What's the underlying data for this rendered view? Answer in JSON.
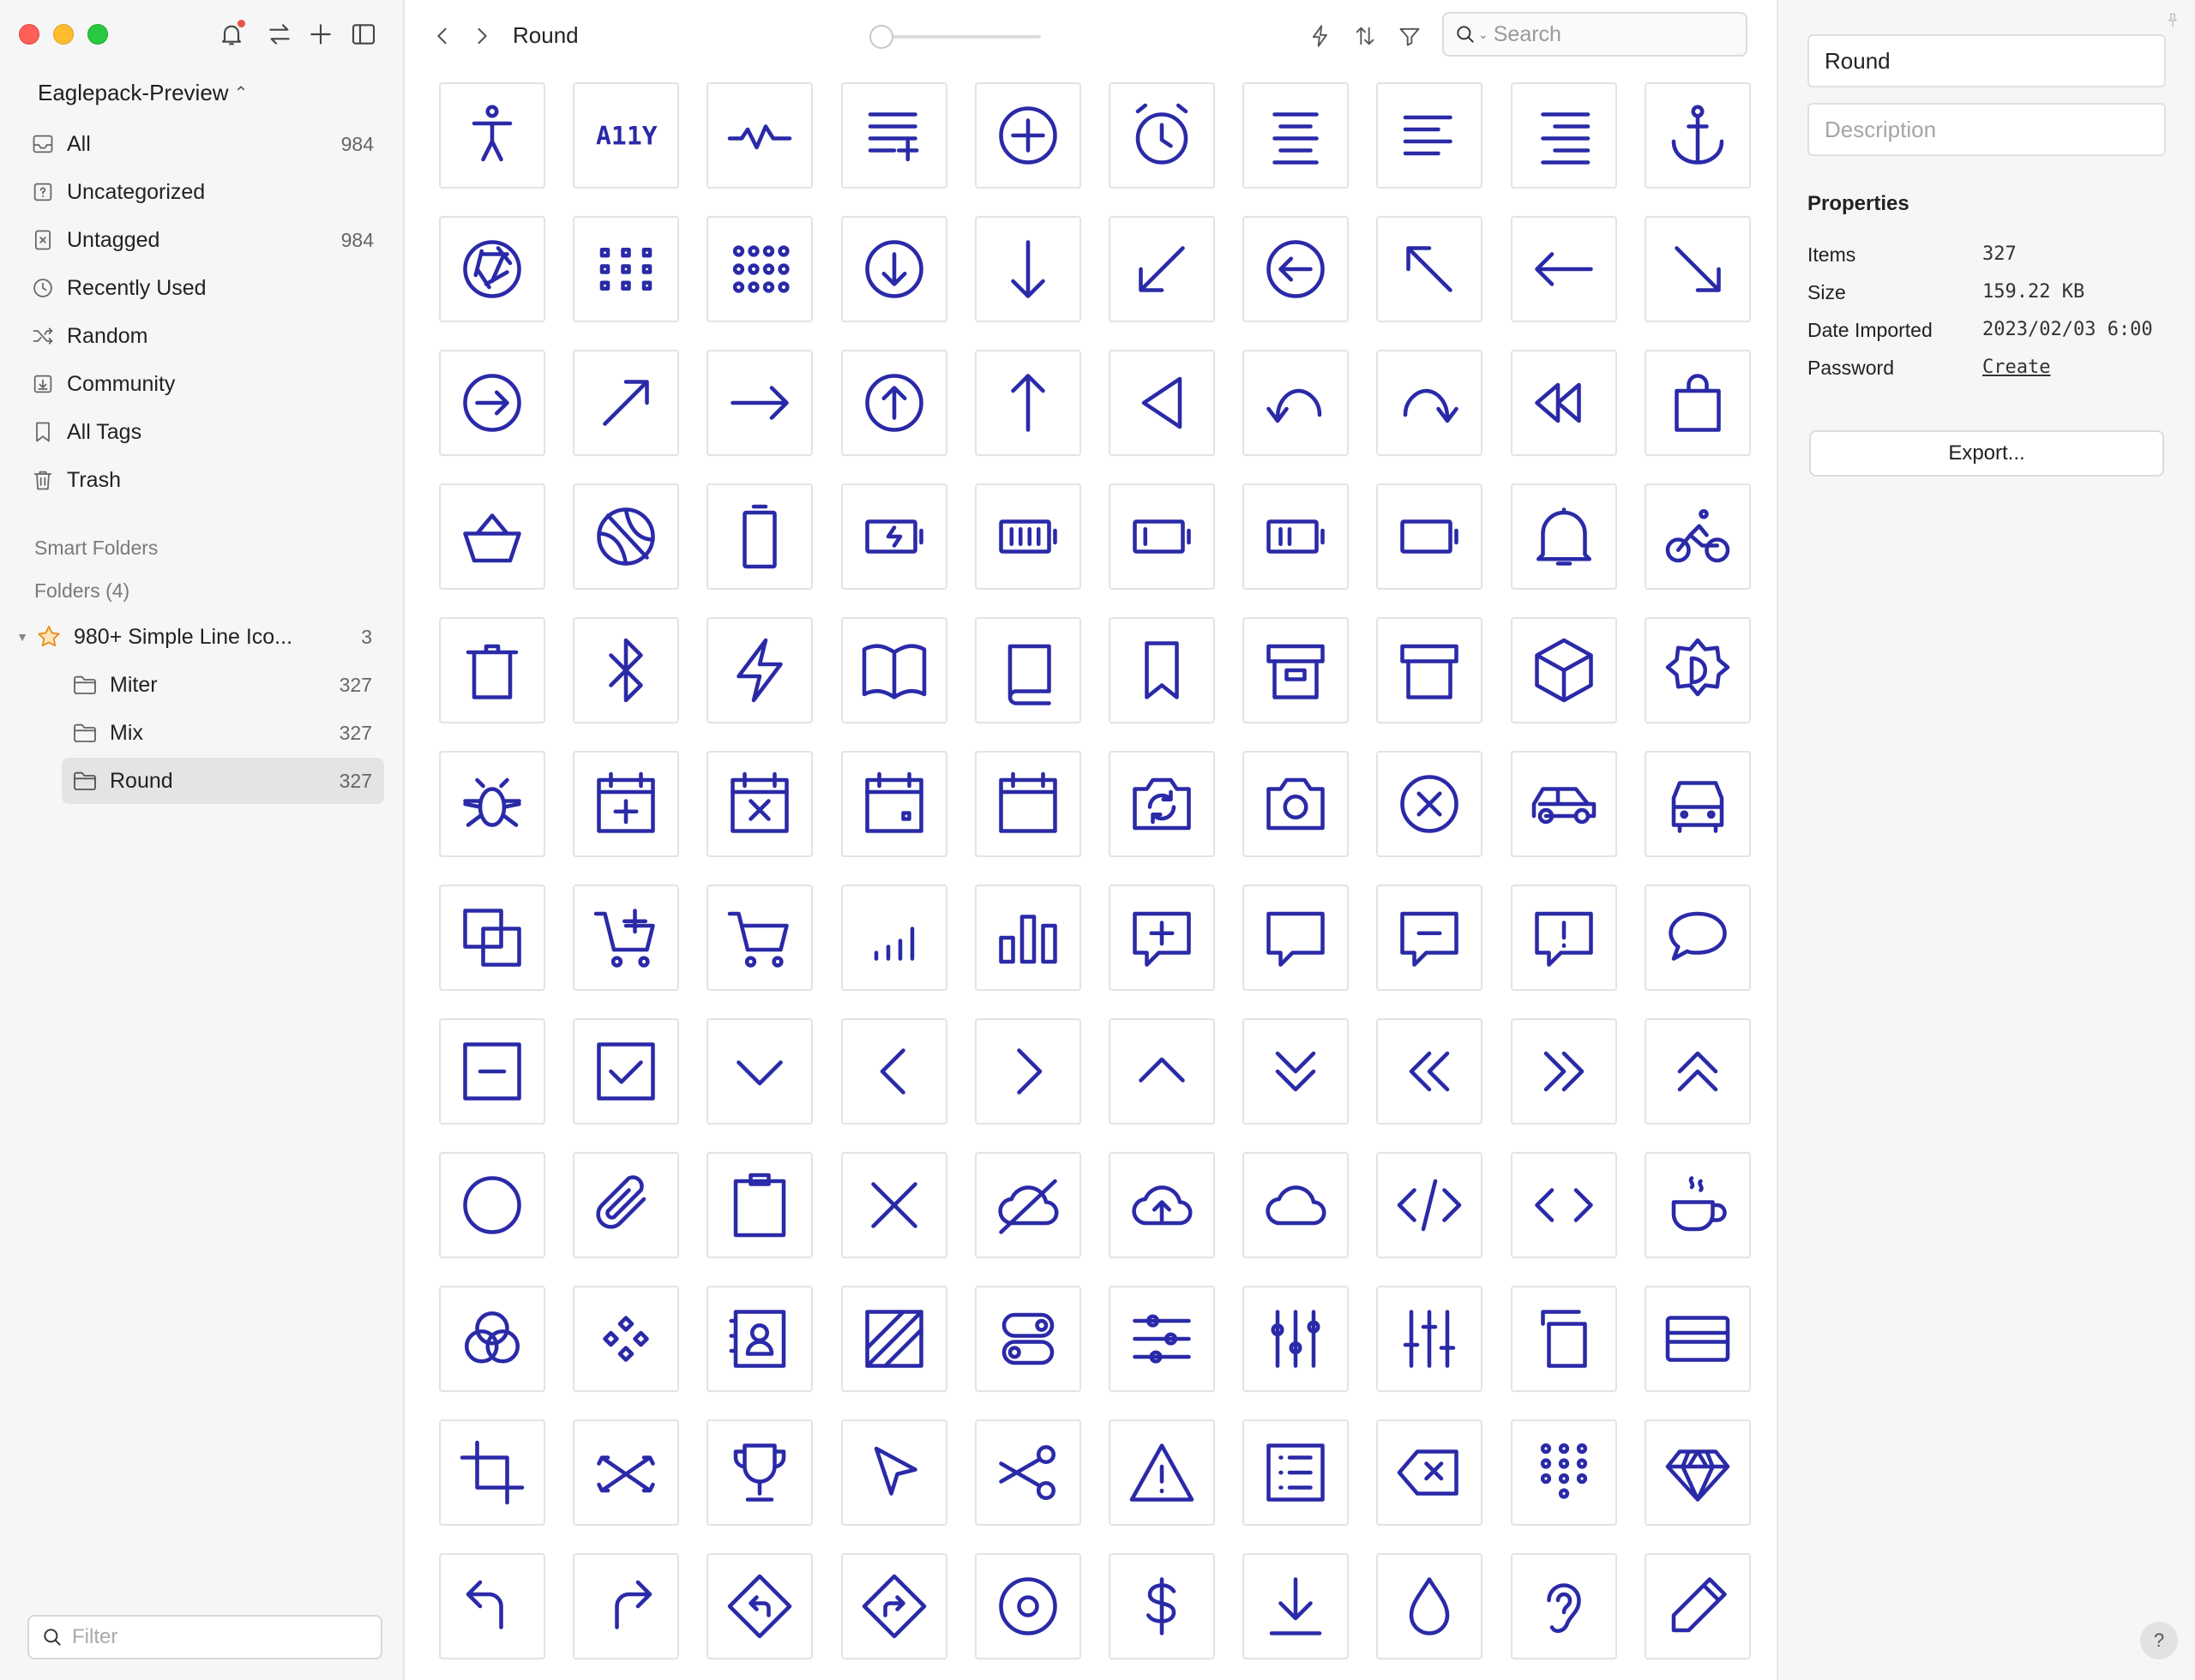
{
  "window": {
    "traffic_lights": [
      "close",
      "minimize",
      "zoom"
    ]
  },
  "sidebar": {
    "library_name": "Eaglepack-Preview",
    "nav_items": [
      {
        "label": "All",
        "count": "984",
        "icon": "inbox-icon"
      },
      {
        "label": "Uncategorized",
        "count": "",
        "icon": "question-box-icon"
      },
      {
        "label": "Untagged",
        "count": "984",
        "icon": "untagged-icon"
      },
      {
        "label": "Recently Used",
        "count": "",
        "icon": "clock-icon"
      },
      {
        "label": "Random",
        "count": "",
        "icon": "shuffle-icon"
      },
      {
        "label": "Community",
        "count": "",
        "icon": "download-box-icon"
      },
      {
        "label": "All Tags",
        "count": "",
        "icon": "bookmark-icon"
      },
      {
        "label": "Trash",
        "count": "",
        "icon": "trash-icon"
      }
    ],
    "smart_folders_header": "Smart Folders",
    "folders_header": "Folders (4)",
    "folders": [
      {
        "label": "980+ Simple Line Ico...",
        "count": "3",
        "icon": "star-icon"
      },
      {
        "label": "Miter",
        "count": "327",
        "icon": "folder-icon"
      },
      {
        "label": "Mix",
        "count": "327",
        "icon": "folder-icon"
      },
      {
        "label": "Round",
        "count": "327",
        "icon": "folder-icon",
        "selected": true
      }
    ],
    "filter_placeholder": "Filter"
  },
  "toolbar": {
    "title": "Round",
    "zoom_level": 0,
    "search_placeholder": "Search"
  },
  "grid": {
    "icon_color": "#2a2aa8",
    "rows": [
      [
        "accessibility",
        "a11y",
        "activity",
        "add-list",
        "add-circle",
        "alarm",
        "align-center",
        "align-left",
        "align-right",
        "anchor"
      ],
      [
        "aperture",
        "apps-grid",
        "apps-dots",
        "arrow-down-circle",
        "arrow-down",
        "arrow-down-left",
        "arrow-left-circle",
        "arrow-up-left",
        "arrow-left",
        "arrow-down-right"
      ],
      [
        "arrow-right-circle",
        "arrow-up-right",
        "arrow-right",
        "arrow-up-circle",
        "arrow-up",
        "back",
        "undo",
        "redo",
        "rewind",
        "bag"
      ],
      [
        "basket",
        "basketball",
        "battery-empty-vertical",
        "battery-charging",
        "battery-full",
        "battery-low",
        "battery-medium",
        "battery-empty",
        "bell",
        "bicycle"
      ],
      [
        "bin",
        "bluetooth",
        "bolt",
        "book-open",
        "book",
        "bookmark",
        "box-archive",
        "box",
        "cube",
        "brightness"
      ],
      [
        "bug",
        "calendar-add",
        "calendar-remove",
        "calendar-date",
        "calendar",
        "camera-switch",
        "camera",
        "cancel-circle",
        "car-side",
        "car-front"
      ],
      [
        "copy-squares",
        "cart-add",
        "cart",
        "chart-bars-small",
        "chart-bars",
        "chat-add",
        "chat",
        "chat-remove",
        "chat-alert",
        "chat-bubble"
      ],
      [
        "minus-square",
        "check-square",
        "chevron-down",
        "chevron-left",
        "chevron-right",
        "chevron-up",
        "chevrons-down",
        "chevrons-left",
        "chevrons-right",
        "chevrons-up"
      ],
      [
        "circle",
        "clip",
        "clipboard",
        "close",
        "cloud-off",
        "cloud-upload",
        "cloud",
        "code",
        "code-brackets",
        "coffee"
      ],
      [
        "color-circles",
        "component",
        "contact",
        "contrast",
        "controls-toggle",
        "controls-sliders-h",
        "controls-sliders-v",
        "controls-sliders-alt",
        "copy",
        "credit-card"
      ],
      [
        "crop",
        "crossing-arrows",
        "trophy",
        "cursor",
        "cut",
        "danger",
        "list-document",
        "delete-key",
        "dialpad",
        "diamond"
      ],
      [
        "direction-left",
        "direction-right",
        "sign-left",
        "sign-right",
        "disc",
        "dollar",
        "download",
        "drop",
        "ear",
        "edit"
      ]
    ]
  },
  "inspector": {
    "name_value": "Round",
    "description_placeholder": "Description",
    "properties_heading": "Properties",
    "properties": [
      {
        "label": "Items",
        "value": "327"
      },
      {
        "label": "Size",
        "value": "159.22 KB"
      },
      {
        "label": "Date Imported",
        "value": "2023/02/03 6:00"
      },
      {
        "label": "Password",
        "value": "Create",
        "link": true
      }
    ],
    "export_label": "Export...",
    "help_label": "?"
  }
}
